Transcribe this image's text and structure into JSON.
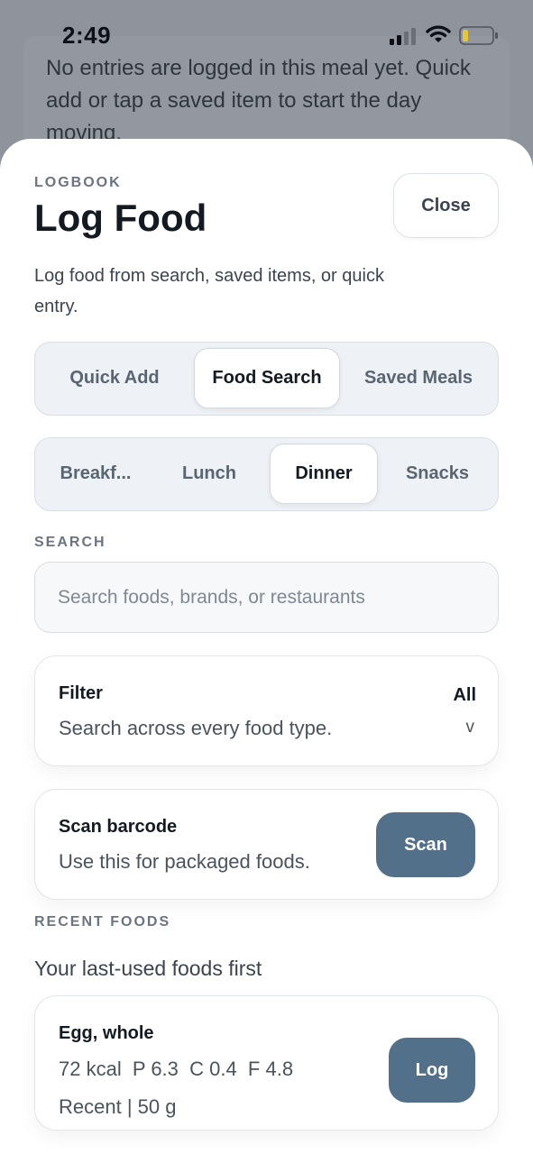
{
  "status_bar": {
    "time": "2:49"
  },
  "background": {
    "empty_text": "No entries are logged in this meal yet. Quick add or tap a saved item to start the day moving."
  },
  "sheet": {
    "eyebrow": "LOGBOOK",
    "title": "Log Food",
    "close_label": "Close",
    "subtitle": "Log food from search, saved items, or quick entry.",
    "modes": [
      {
        "label": "Quick Add",
        "active": false
      },
      {
        "label": "Food Search",
        "active": true
      },
      {
        "label": "Saved Meals",
        "active": false
      }
    ],
    "meals": [
      {
        "label": "Breakf...",
        "active": false
      },
      {
        "label": "Lunch",
        "active": false
      },
      {
        "label": "Dinner",
        "active": true
      },
      {
        "label": "Snacks",
        "active": false
      }
    ],
    "search": {
      "section_label": "SEARCH",
      "placeholder": "Search foods, brands, or restaurants",
      "value": ""
    },
    "filter": {
      "title": "Filter",
      "description": "Search across every food type.",
      "value": "All",
      "chevron": "v"
    },
    "scan": {
      "title": "Scan barcode",
      "description": "Use this for packaged foods.",
      "button_label": "Scan"
    },
    "recent": {
      "section_label": "RECENT FOODS",
      "subtitle": "Your last-used foods first",
      "items": [
        {
          "name": "Egg, whole",
          "macros": "72 kcal  P 6.3  C 0.4  F 4.8",
          "meta": "Recent | 50 g",
          "button_label": "Log"
        }
      ]
    }
  },
  "colors": {
    "accent": "#53708b",
    "overlay": "#8f949c",
    "segment_bg": "#eef1f5"
  }
}
